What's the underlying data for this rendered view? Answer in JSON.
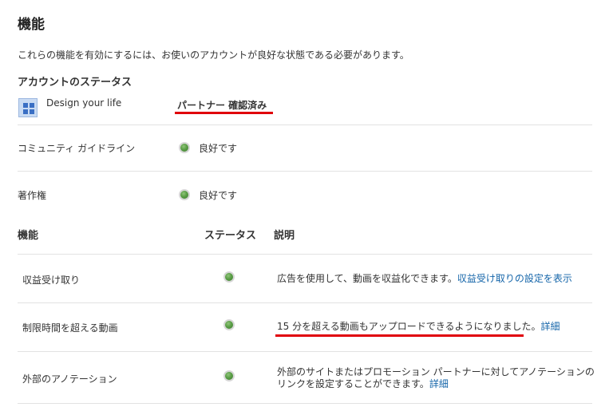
{
  "page": {
    "title": "機能",
    "intro": "これらの機能を有効にするには、お使いのアカウントが良好な状態である必要があります。"
  },
  "account_status": {
    "heading": "アカウントのステータス",
    "channel_name": "Design your life",
    "partner_badge": "パートナー 確認済み",
    "rows": [
      {
        "label": "コミュニティ ガイドライン",
        "status": "良好です"
      },
      {
        "label": "著作権",
        "status": "良好です"
      }
    ]
  },
  "features": {
    "columns": [
      "機能",
      "ステータス",
      "説明"
    ],
    "rows": [
      {
        "name": "収益受け取り",
        "status_color": "#5a9e46",
        "description": "広告を使用して、動画を収益化できます。",
        "link": "収益受け取りの設定を表示"
      },
      {
        "name": "制限時間を超える動画",
        "status_color": "#5a9e46",
        "description": "15 分を超える動画もアップロードできるようになりました。",
        "link": "詳細"
      },
      {
        "name": "外部のアノテーション",
        "status_color": "#5a9e46",
        "description_line1": "外部のサイトまたはプロモーション パートナーに対してアノテーションの",
        "description_line2": "リンクを設定することができます。",
        "link": "詳細"
      }
    ]
  },
  "colors": {
    "status_ok": "#5a9e46",
    "link": "#1666aa",
    "highlight_underline": "#e0000b"
  }
}
